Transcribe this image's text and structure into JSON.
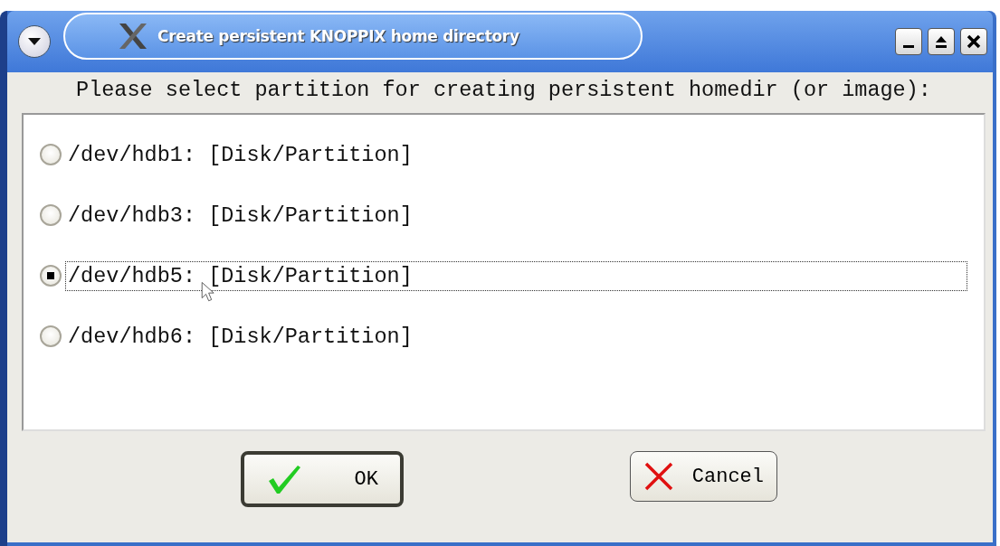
{
  "window": {
    "title": "Create persistent KNOPPIX home directory"
  },
  "prompt": "Please select partition for creating persistent homedir (or image):",
  "partitions": [
    {
      "label": "/dev/hdb1: [Disk/Partition]",
      "selected": false
    },
    {
      "label": "/dev/hdb3: [Disk/Partition]",
      "selected": false
    },
    {
      "label": "/dev/hdb5: [Disk/Partition]",
      "selected": true
    },
    {
      "label": "/dev/hdb6: [Disk/Partition]",
      "selected": false
    }
  ],
  "buttons": [
    {
      "label": "OK",
      "kind": "ok",
      "default": true
    },
    {
      "label": "Cancel",
      "kind": "cancel",
      "default": false
    }
  ]
}
